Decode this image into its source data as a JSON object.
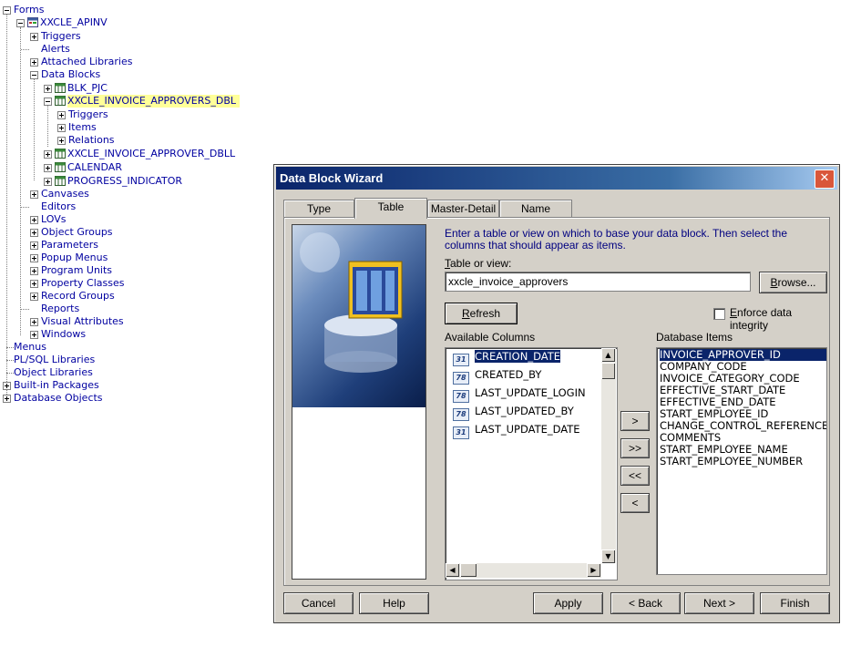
{
  "tree": {
    "root": "Forms",
    "module": "XXCLE_APINV",
    "items": [
      {
        "label": "Triggers"
      },
      {
        "label": "Alerts"
      },
      {
        "label": "Attached Libraries"
      },
      {
        "label": "Data Blocks"
      },
      {
        "label": "BLK_PJC"
      },
      {
        "label": "XXCLE_INVOICE_APPROVERS_DBL"
      },
      {
        "label": "Triggers"
      },
      {
        "label": "Items"
      },
      {
        "label": "Relations"
      },
      {
        "label": "XXCLE_INVOICE_APPROVER_DBLL"
      },
      {
        "label": "CALENDAR"
      },
      {
        "label": "PROGRESS_INDICATOR"
      },
      {
        "label": "Canvases"
      },
      {
        "label": "Editors"
      },
      {
        "label": "LOVs"
      },
      {
        "label": "Object Groups"
      },
      {
        "label": "Parameters"
      },
      {
        "label": "Popup Menus"
      },
      {
        "label": "Program Units"
      },
      {
        "label": "Property Classes"
      },
      {
        "label": "Record Groups"
      },
      {
        "label": "Reports"
      },
      {
        "label": "Visual Attributes"
      },
      {
        "label": "Windows"
      },
      {
        "label": "Menus"
      },
      {
        "label": "PL/SQL Libraries"
      },
      {
        "label": "Object Libraries"
      },
      {
        "label": "Built-in Packages"
      },
      {
        "label": "Database Objects"
      }
    ]
  },
  "dialog": {
    "title": "Data Block Wizard",
    "close_glyph": "✕",
    "tabs": [
      "Type",
      "Table",
      "Master-Detail",
      "Name"
    ],
    "active_tab": "Table",
    "instructions": "Enter a table or view on which to base your data block.  Then select the columns that should appear as items.",
    "table_label": "Table or view:",
    "table_value": "xxcle_invoice_approvers",
    "browse_label": "Browse...",
    "refresh_label": "Refresh",
    "enforce_label": "Enforce data integrity",
    "enforce_checked": false,
    "available_label": "Available Columns",
    "database_items_label": "Database Items",
    "available_columns": [
      {
        "name": "CREATION_DATE",
        "type": "date",
        "selected": true
      },
      {
        "name": "CREATED_BY",
        "type": "num",
        "selected": false
      },
      {
        "name": "LAST_UPDATE_LOGIN",
        "type": "num",
        "selected": false
      },
      {
        "name": "LAST_UPDATED_BY",
        "type": "num",
        "selected": false
      },
      {
        "name": "LAST_UPDATE_DATE",
        "type": "date",
        "selected": false
      }
    ],
    "type_glyphs": {
      "num": "78",
      "date": "31"
    },
    "database_items": [
      "INVOICE_APPROVER_ID",
      "COMPANY_CODE",
      "INVOICE_CATEGORY_CODE",
      "EFFECTIVE_START_DATE",
      "EFFECTIVE_END_DATE",
      "START_EMPLOYEE_ID",
      "CHANGE_CONTROL_REFERENCE",
      "COMMENTS",
      "START_EMPLOYEE_NAME",
      "START_EMPLOYEE_NUMBER"
    ],
    "move_buttons": [
      ">",
      ">>",
      "<<",
      "<"
    ],
    "buttons": {
      "cancel": "Cancel",
      "help": "Help",
      "apply": "Apply",
      "back": "< Back",
      "next": "Next >",
      "finish": "Finish"
    }
  }
}
